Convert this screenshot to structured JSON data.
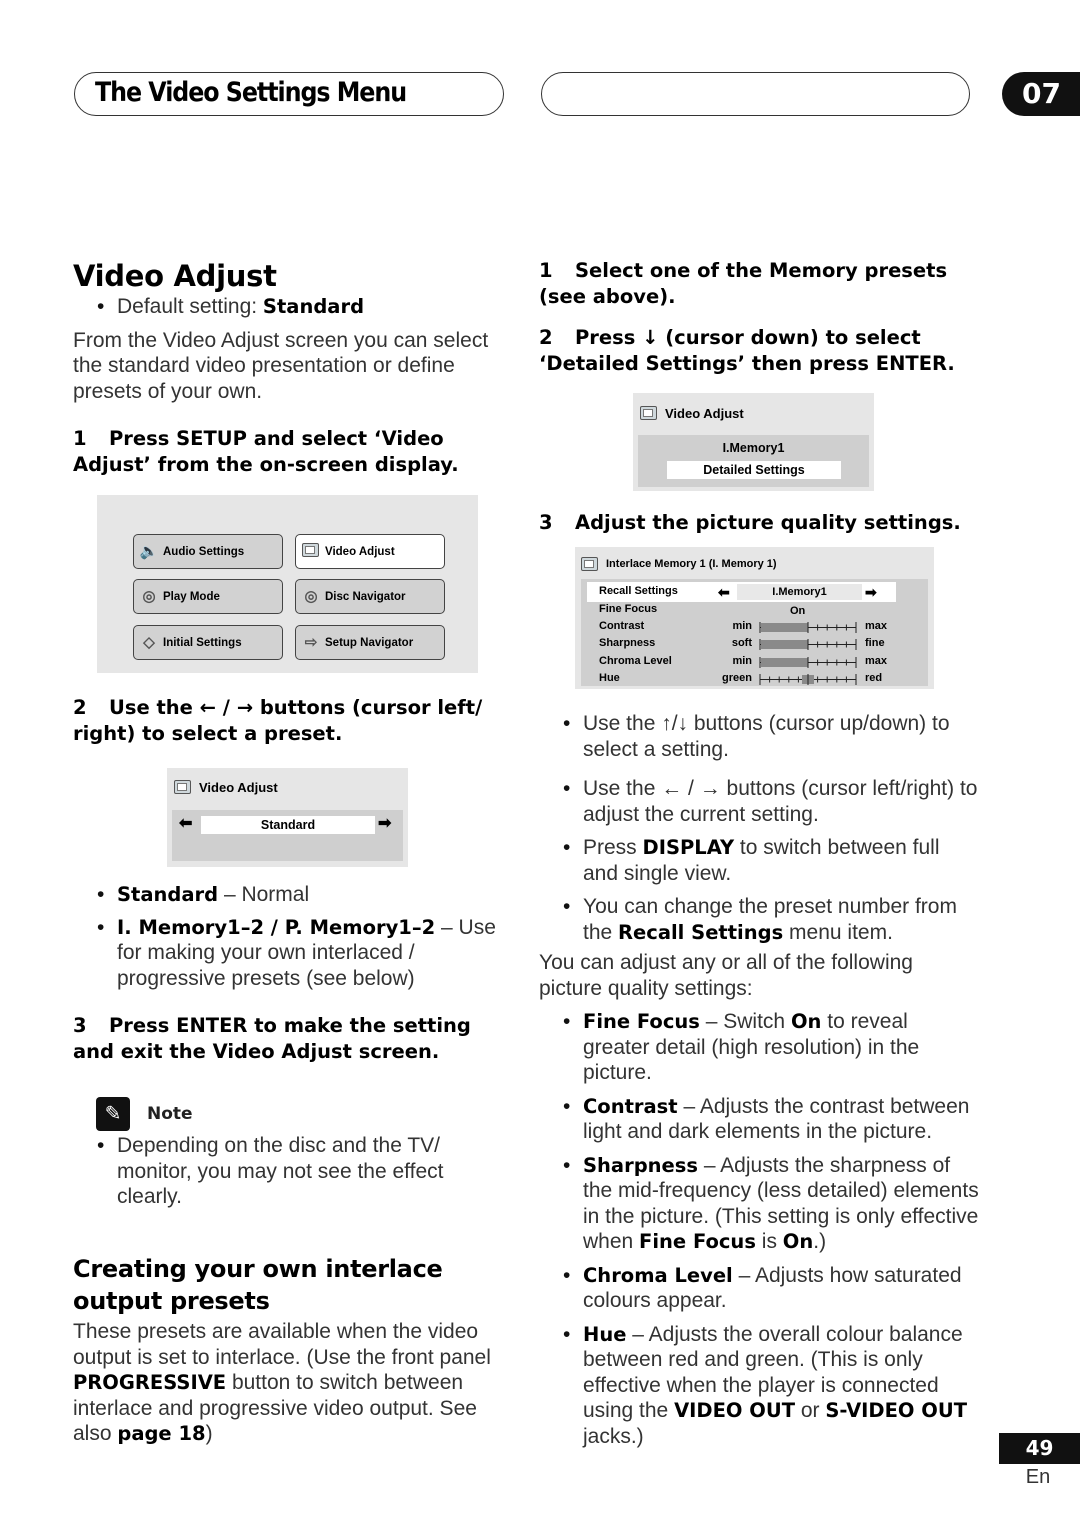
{
  "header": {
    "section_title": "The Video Settings Menu",
    "chapter": "07"
  },
  "left": {
    "title": "Video Adjust",
    "default_setting_label": "Default setting: ",
    "default_setting_value": "Standard",
    "intro": "From the Video Adjust screen you can select the standard video presentation or define presets of your own.",
    "step1_num": "1",
    "step1": "Press SETUP and select ‘Video Adjust’ from the on-screen display.",
    "setup_menu": {
      "items": [
        {
          "label": "Audio Settings",
          "icon": "speaker-icon",
          "glyph": "🔈",
          "active": false
        },
        {
          "label": "Video Adjust",
          "icon": "tv-icon",
          "glyph": "",
          "active": true
        },
        {
          "label": "Play Mode",
          "icon": "disc-play-icon",
          "glyph": "◎",
          "active": false
        },
        {
          "label": "Disc Navigator",
          "icon": "disc-navigator-icon",
          "glyph": "◎",
          "active": false
        },
        {
          "label": "Initial Settings",
          "icon": "initial-settings-icon",
          "glyph": "◇",
          "active": false
        },
        {
          "label": "Setup Navigator",
          "icon": "setup-navigator-icon",
          "glyph": "⇨",
          "active": false
        }
      ]
    },
    "step2_num": "2",
    "step2": "Use the ← / → buttons (cursor left/ right) to select a preset.",
    "preset_screen": {
      "title": "Video Adjust",
      "value": "Standard",
      "left_arrow": "⬅",
      "right_arrow": "➡"
    },
    "presets": [
      {
        "name": "Standard",
        "desc": " – Normal"
      },
      {
        "name": "I. Memory1–2 / P. Memory1–2",
        "desc": " – Use for making your own interlaced / progressive presets (see below)"
      }
    ],
    "step3_num": "3",
    "step3": "Press ENTER to make the setting and exit the Video Adjust screen.",
    "note_label": "Note",
    "note_text": "Depending on the disc and the TV/ monitor, you may not see the effect clearly.",
    "subtitle": "Creating your own interlace output presets",
    "sub_p1": "These presets are available when the video output is set to interlace. (Use the front panel ",
    "sub_bold1": "PROGRESSIVE",
    "sub_p2": " button to switch between interlace and progressive video output. See also ",
    "sub_bold2": "page 18",
    "sub_p3": ")"
  },
  "right": {
    "step1_num": "1",
    "step1": "Select one of the Memory presets (see above).",
    "step2_num": "2",
    "step2": "Press ↓ (cursor down) to select ‘Detailed Settings’ then press ENTER.",
    "memory_screen": {
      "title": "Video Adjust",
      "preset": "I.Memory1",
      "button": "Detailed Settings"
    },
    "step3_num": "3",
    "step3": "Adjust the picture quality settings.",
    "detail_screen": {
      "title": "Interlace Memory 1 (I. Memory 1)",
      "recall_label": "Recall Settings",
      "recall_value": "I.Memory1",
      "fine_focus_label": "Fine Focus",
      "fine_focus_value": "On",
      "sliders": [
        {
          "label": "Contrast",
          "low": "min",
          "high": "max",
          "value": 0,
          "range": [
            -5,
            5
          ],
          "style": "fill"
        },
        {
          "label": "Sharpness",
          "low": "soft",
          "high": "fine",
          "value": 0,
          "range": [
            -5,
            5
          ],
          "style": "fill"
        },
        {
          "label": "Chroma Level",
          "low": "min",
          "high": "max",
          "value": 0,
          "range": [
            -5,
            5
          ],
          "style": "fill"
        },
        {
          "label": "Hue",
          "low": "green",
          "high": "red",
          "value": 0,
          "range": [
            -5,
            5
          ],
          "style": "marker"
        }
      ]
    },
    "bullets": [
      {
        "pre": "Use the ↑/↓ buttons (cursor up/down) to select a setting.",
        "bold": "",
        "post": ""
      },
      {
        "pre": "Use the ← / → buttons (cursor left/right) to adjust the current setting.",
        "bold": "",
        "post": ""
      },
      {
        "pre": "Press ",
        "bold": "DISPLAY",
        "post": " to switch between full and single view."
      },
      {
        "pre": "You can change the preset number from the ",
        "bold": "Recall Settings",
        "post": " menu item."
      }
    ],
    "adjust_intro": "You can adjust any or all of the following picture quality settings:",
    "settings": [
      {
        "name": "Fine Focus",
        "desc_html": " – Switch <b>On</b> to reveal greater detail (high resolution) in the picture."
      },
      {
        "name": "Contrast",
        "desc_html": " – Adjusts the contrast between light and dark elements in the picture."
      },
      {
        "name": "Sharpness",
        "desc_html": " – Adjusts the sharpness of the mid-frequency (less detailed) elements in the picture. (This setting is only effective when <b>Fine Focus</b> is <b>On</b>.)"
      },
      {
        "name": "Chroma Level",
        "desc_html": " – Adjusts how saturated colours appear."
      },
      {
        "name": "Hue",
        "desc_html": " – Adjusts the overall colour balance between red and green. (This is only effective when the player is connected using the <b>VIDEO OUT</b> or <b>S-VIDEO OUT</b> jacks.)"
      }
    ]
  },
  "footer": {
    "page": "49",
    "lang": "En"
  }
}
